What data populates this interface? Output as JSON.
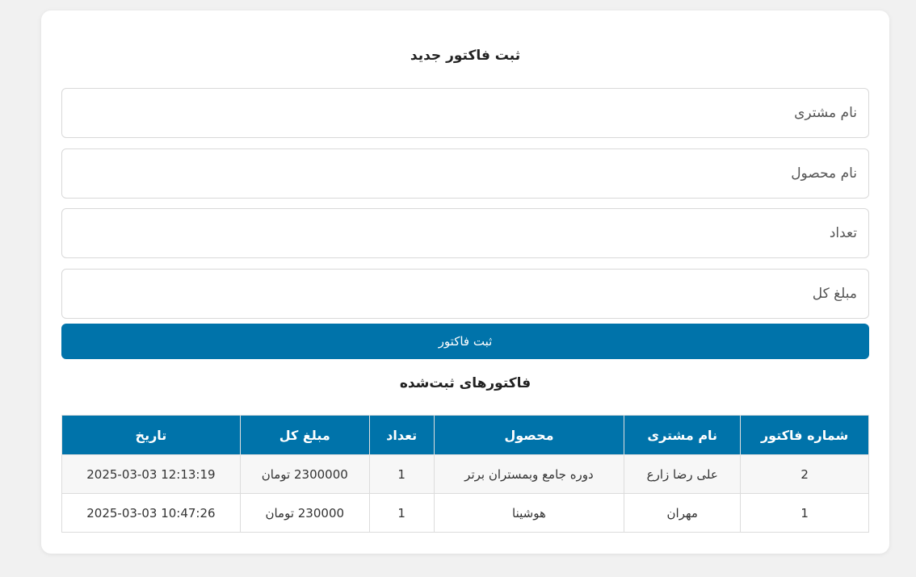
{
  "form": {
    "title": "ثبت فاکتور جدید",
    "customer_placeholder": "نام مشتری",
    "product_placeholder": "نام محصول",
    "quantity_placeholder": "تعداد",
    "total_placeholder": "مبلغ کل",
    "submit_label": "ثبت فاکتور"
  },
  "invoices": {
    "title": "فاکتورهای ثبت‌شده",
    "columns": [
      "شماره فاکتور",
      "نام مشتری",
      "محصول",
      "تعداد",
      "مبلغ کل",
      "تاریخ"
    ],
    "rows": [
      {
        "id": "2",
        "customer": "علی رضا زارع",
        "product": "دوره جامع وبمستران برتر",
        "qty": "1",
        "total": "2300000 تومان",
        "date": "2025-03-03 12:13:19"
      },
      {
        "id": "1",
        "customer": "مهران",
        "product": "هوشینا",
        "qty": "1",
        "total": "230000 تومان",
        "date": "2025-03-03 10:47:26"
      }
    ]
  },
  "colors": {
    "accent": "#0073aa",
    "page_bg": "#f1f1f1",
    "card_bg": "#ffffff"
  }
}
